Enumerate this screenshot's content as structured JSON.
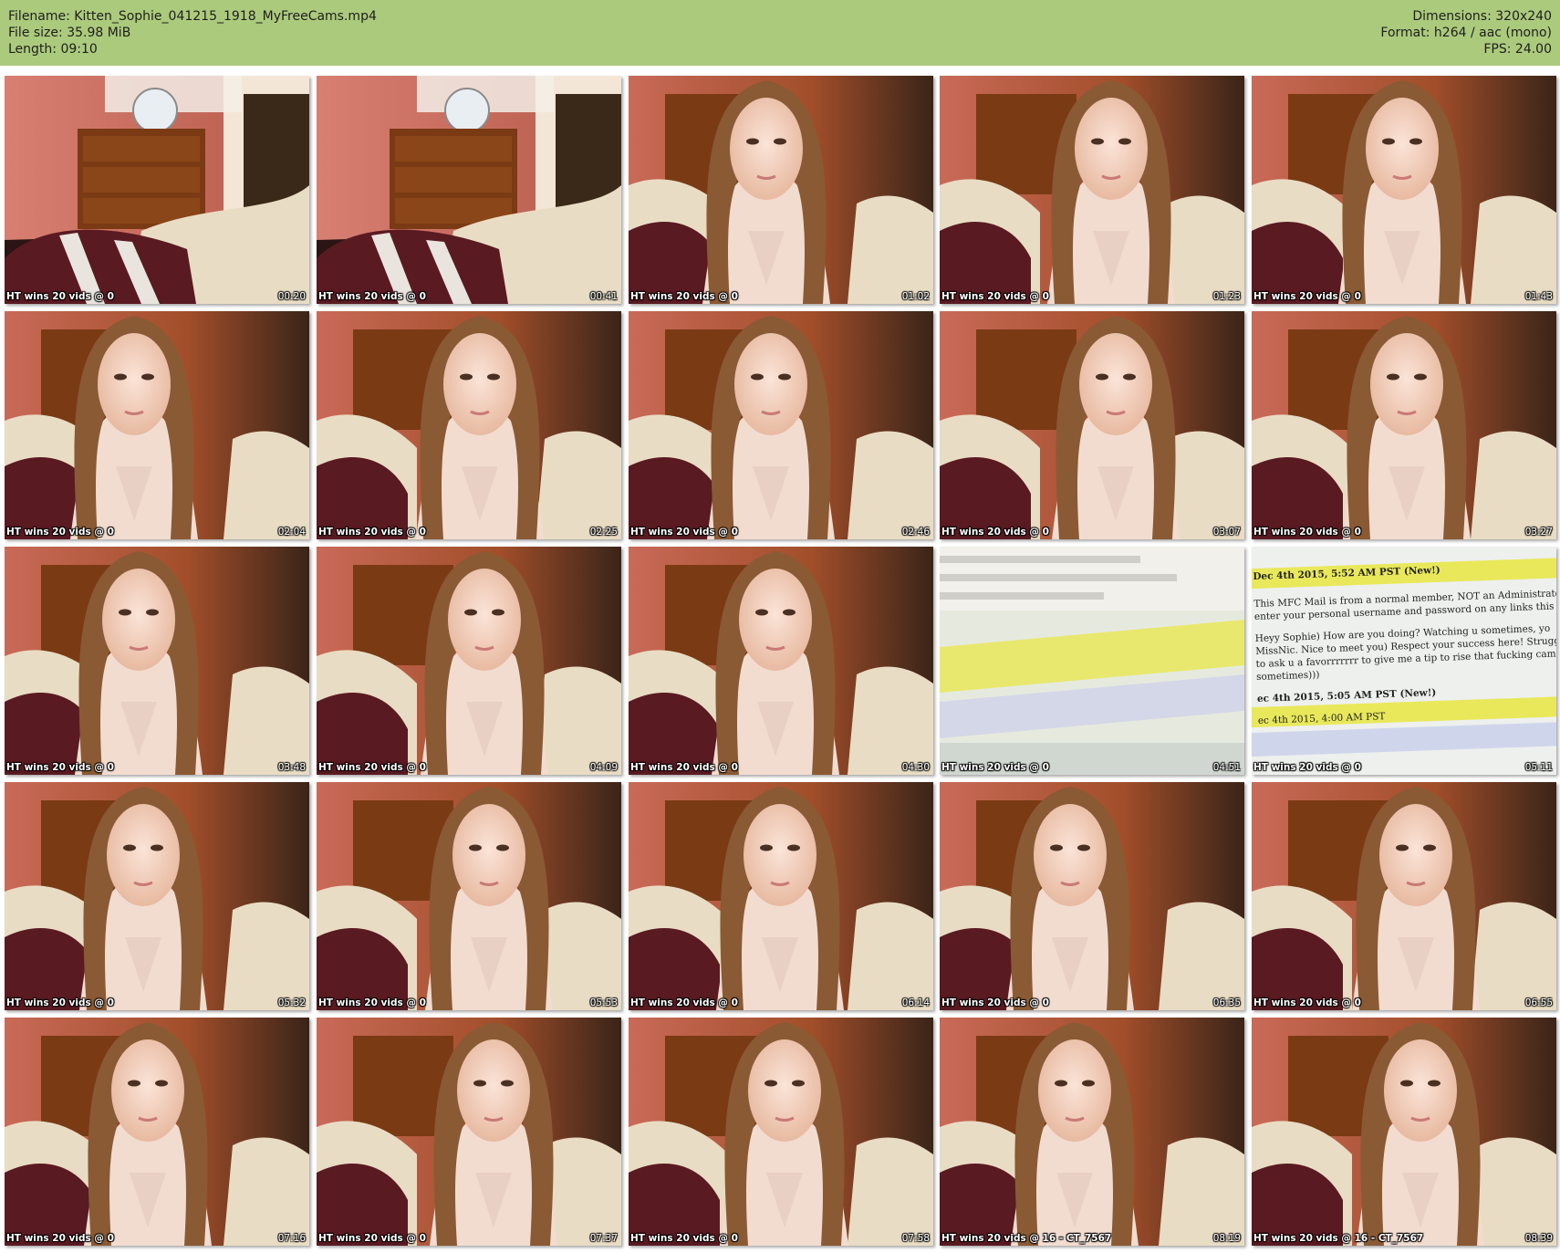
{
  "header": {
    "filename": "Filename: Kitten_Sophie_041215_1918_MyFreeCams.mp4",
    "filesize": "File size: 35.98 MiB",
    "length": "Length: 09:10",
    "dimensions": "Dimensions: 320x240",
    "format": "Format: h264 / aac (mono)",
    "fps": "FPS: 24.00"
  },
  "thumbnails": [
    {
      "caption": "HT wins 20 vids @ 0",
      "time": "00:20",
      "scene": "room"
    },
    {
      "caption": "HT wins 20 vids @ 0",
      "time": "00:41",
      "scene": "room"
    },
    {
      "caption": "HT wins 20 vids @ 0",
      "time": "01:02",
      "scene": "person"
    },
    {
      "caption": "HT wins 20 vids @ 0",
      "time": "01:23",
      "scene": "person"
    },
    {
      "caption": "HT wins 20 vids @ 0",
      "time": "01:43",
      "scene": "person"
    },
    {
      "caption": "HT wins 20 vids @ 0",
      "time": "02:04",
      "scene": "person"
    },
    {
      "caption": "HT wins 20 vids @ 0",
      "time": "02:25",
      "scene": "person"
    },
    {
      "caption": "HT wins 20 vids @ 0",
      "time": "02:46",
      "scene": "person"
    },
    {
      "caption": "HT wins 20 vids @ 0",
      "time": "03:07",
      "scene": "person"
    },
    {
      "caption": "HT wins 20 vids @ 0",
      "time": "03:27",
      "scene": "person"
    },
    {
      "caption": "HT wins 20 vids @ 0",
      "time": "03:48",
      "scene": "person"
    },
    {
      "caption": "HT wins 20 vids @ 0",
      "time": "04:09",
      "scene": "person"
    },
    {
      "caption": "HT wins 20 vids @ 0",
      "time": "04:30",
      "scene": "person"
    },
    {
      "caption": "HT wins 20 vids @ 0",
      "time": "04:51",
      "scene": "screen-blurred"
    },
    {
      "caption": "HT wins 20 vids @ 0",
      "time": "05:11",
      "scene": "screen-mail"
    },
    {
      "caption": "HT wins 20 vids @ 0",
      "time": "05:32",
      "scene": "person"
    },
    {
      "caption": "HT wins 20 vids @ 0",
      "time": "05:53",
      "scene": "person"
    },
    {
      "caption": "HT wins 20 vids @ 0",
      "time": "06:14",
      "scene": "person"
    },
    {
      "caption": "HT wins 20 vids @ 0",
      "time": "06:35",
      "scene": "person"
    },
    {
      "caption": "HT wins 20 vids @ 0",
      "time": "06:55",
      "scene": "person"
    },
    {
      "caption": "HT wins 20 vids @ 0",
      "time": "07:16",
      "scene": "person"
    },
    {
      "caption": "HT wins 20 vids @ 0",
      "time": "07:37",
      "scene": "person"
    },
    {
      "caption": "HT wins 20 vids @ 0",
      "time": "07:58",
      "scene": "person"
    },
    {
      "caption": "HT wins 20 vids @ 16 - CT_7567",
      "time": "08:19",
      "scene": "person"
    },
    {
      "caption": "HT wins 20 vids @ 16 - CT_7567",
      "time": "08:39",
      "scene": "person"
    }
  ],
  "mail_screen": {
    "line1": "Dec 4th 2015, 5:52 AM PST (New!)",
    "line2": "This MFC Mail is from a normal member, NOT an Administrator,",
    "line3": "enter your personal username and password on any links this m",
    "line4": "Heyy Sophie) How are you doing? Watching u sometimes, yo",
    "line5": "MissNic. Nice to meet you) Respect your success here! Strugg",
    "line6": "to ask u a favorrrrrrr to give me a tip to rise that fucking came",
    "line7": "sometimes)))",
    "line8": "ec 4th 2015, 5:05 AM PST (New!)",
    "line9": "ec 4th 2015, 4:00 AM PST"
  },
  "colors": {
    "header_bg": "#acca7c",
    "wall": "#c86a5a",
    "dresser": "#7a3a14",
    "blanket": "#e9dcc4",
    "pillow": "#5a1a22",
    "hair": "#8a5a34",
    "skin": "#f0cdb8",
    "highlight": "#e9e85a"
  }
}
